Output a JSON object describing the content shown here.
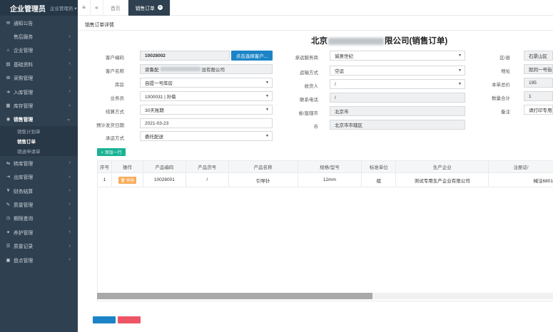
{
  "app": {
    "brand": "企业管理员",
    "brand_sub": "企业管理员"
  },
  "sidebar": {
    "items": [
      {
        "icon": "envelope-icon",
        "glyph": "✉",
        "label": "通知公告",
        "chevron": false
      },
      {
        "icon": "",
        "glyph": "",
        "label": "售后服务",
        "chevron": true
      },
      {
        "icon": "home-icon",
        "glyph": "⌂",
        "label": "企业管理",
        "chevron": true
      },
      {
        "icon": "database-icon",
        "glyph": "▤",
        "label": "基础资料",
        "chevron": true
      },
      {
        "icon": "cart-icon",
        "glyph": "⊞",
        "label": "采购管理",
        "chevron": true
      },
      {
        "icon": "sign-in-icon",
        "glyph": "➜",
        "label": "入库管理",
        "chevron": true
      },
      {
        "icon": "warehouse-icon",
        "glyph": "▦",
        "label": "库存管理",
        "chevron": true
      }
    ],
    "open_item": {
      "icon": "sales-icon",
      "glyph": "◉",
      "label": "销售管理"
    },
    "sub_items": [
      "销售计划单",
      "销售订单",
      "销退申请单"
    ],
    "items_after": [
      {
        "icon": "transfer-icon",
        "glyph": "⇆",
        "label": "转库管理"
      },
      {
        "icon": "sign-out-icon",
        "glyph": "⇥",
        "label": "出库管理"
      },
      {
        "icon": "finance-icon",
        "glyph": "¥",
        "label": "财务结算"
      },
      {
        "icon": "quality-icon",
        "glyph": "✎",
        "label": "质量管理"
      },
      {
        "icon": "expiry-icon",
        "glyph": "◷",
        "label": "期限查询"
      },
      {
        "icon": "maintenance-icon",
        "glyph": "✦",
        "label": "养护管理"
      },
      {
        "icon": "record-icon",
        "glyph": "☰",
        "label": "质量记录"
      },
      {
        "icon": "inventory-icon",
        "glyph": "▣",
        "label": "盘点管理"
      }
    ]
  },
  "topbar": {
    "home_tab": "首页",
    "active_tab": "销售订单"
  },
  "content": {
    "breadcrumb": "销售订单详情",
    "title_prefix": "北京",
    "title_suffix": "限公司(销售订单)",
    "form": {
      "customer_code_label": "客户编码",
      "customer_code": "10028002",
      "select_customer_btn": "点击选择客户...",
      "customer_name_label": "客户名称",
      "customer_name_prefix": "资鲁配",
      "customer_name_suffix": "设有限公司",
      "warehouse_label": "库房",
      "warehouse": "自提一号库房",
      "salesman_label": "业务员",
      "salesman": "1000031 | 孙菊",
      "settlement_label": "结算方式",
      "settlement": "30天账期",
      "ship_date_label": "预计发货日期",
      "ship_date": "2021-03-23",
      "carrier_mode_label": "承运方式",
      "carrier_mode": "委托配送",
      "carrier_label": "承运服务商",
      "carrier": "诚意世纪",
      "transport_label": "运输方式",
      "transport": "空运",
      "receiver_label": "收货人",
      "receiver": "/",
      "phone_label": "联系电话",
      "phone": "/",
      "province_label": "省/直辖市",
      "province": "北京市",
      "city_label": "市",
      "city": "北京市市辖区",
      "district_label": "区/县",
      "district": "石景山区",
      "address_label": "地址",
      "address": "就同一号街",
      "total_price_label": "本单总价",
      "total_price": "195",
      "qty_total_label": "数量合计",
      "qty_total": "1",
      "remark_label": "备注",
      "remark": "请打印专用票"
    },
    "add_row_btn": "+ 添加一行",
    "table": {
      "headers": [
        "序号",
        "操作",
        "产品编码",
        "产品货号",
        "产品名称",
        "规格/型号",
        "标准单位",
        "生产企业",
        "注册证/"
      ],
      "rows": [
        {
          "index": "1",
          "action": "移除",
          "code": "10028001",
          "article": "/",
          "name": "引导针",
          "spec": "12mm",
          "unit": "组",
          "maker": "测试专用生产企业有限公司",
          "reg": "械注6801"
        }
      ]
    }
  },
  "colors": {
    "sidebar": "#2f4050",
    "primary": "#1c84c6",
    "success": "#1ab394",
    "warning": "#f8ac59",
    "danger": "#ed5565"
  }
}
